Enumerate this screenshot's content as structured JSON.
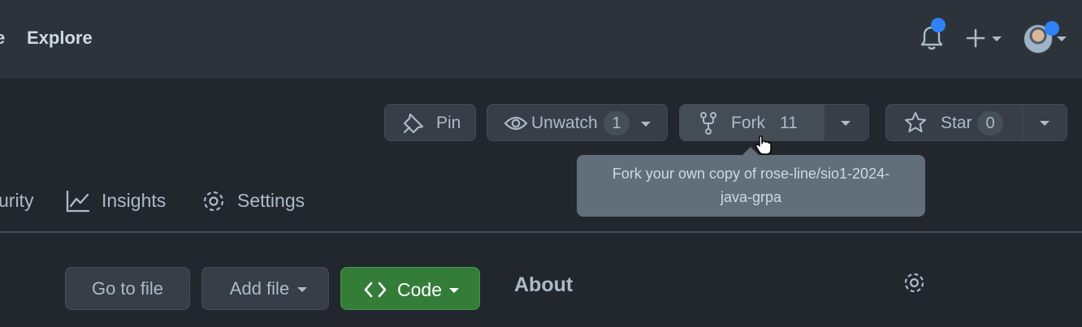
{
  "header": {
    "nav_partial": "e",
    "nav_explore": "Explore",
    "icons": [
      "bell-icon",
      "plus-icon",
      "avatar"
    ],
    "notification_color": "#2f81f7"
  },
  "repo_actions": {
    "pin_label": "Pin",
    "unwatch_label": "Unwatch",
    "watch_count": "1",
    "fork_label": "Fork",
    "fork_count": "11",
    "star_label": "Star",
    "star_count": "0"
  },
  "tooltip": {
    "text": "Fork your own copy of rose-line/sio1-2024-java-grpa"
  },
  "tabs": {
    "security_partial": "urity",
    "insights": "Insights",
    "settings": "Settings"
  },
  "file_actions": {
    "go_to_file": "Go to file",
    "add_file": "Add file",
    "code": "Code",
    "code_color": "#347d39"
  },
  "sidebar": {
    "about_title": "About"
  }
}
